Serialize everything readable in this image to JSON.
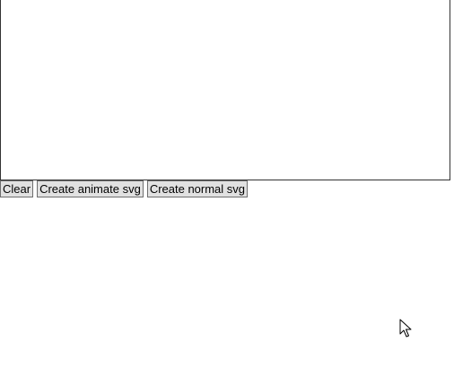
{
  "canvas": {
    "background": "#ffffff",
    "border_color": "#333333"
  },
  "toolbar": {
    "clear_label": "Clear",
    "create_animate_label": "Create animate svg",
    "create_normal_label": "Create normal svg"
  },
  "colors": {
    "button_bg": "#e1e1e1",
    "button_border": "#6e6e6e"
  },
  "pointer": {
    "icon": "mouse-pointer-icon"
  }
}
